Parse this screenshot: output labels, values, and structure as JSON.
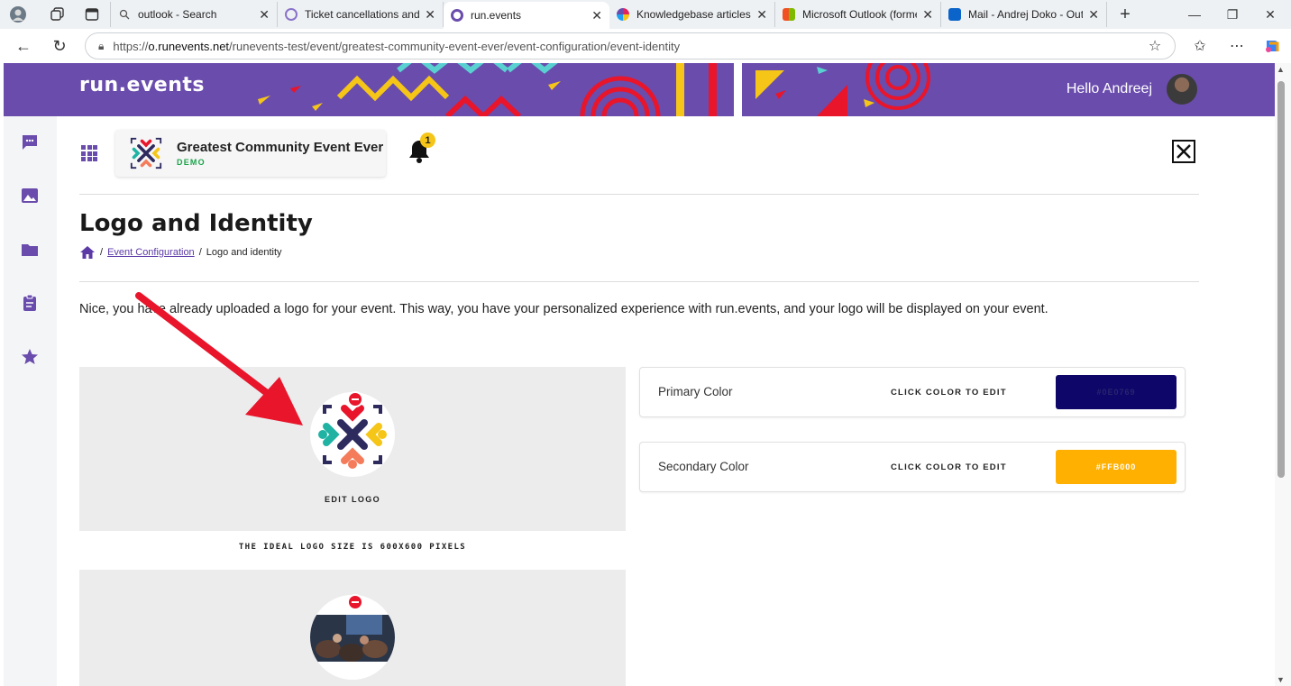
{
  "browser": {
    "tabs": [
      {
        "title": "outlook - Search",
        "fav_color": "#6b6b6b",
        "active": false
      },
      {
        "title": "Ticket cancellations and n",
        "fav_color": "#8a72c9",
        "active": false
      },
      {
        "title": "run.events",
        "fav_color": "#6a4cad",
        "active": true
      },
      {
        "title": "Knowledgebase articles | r",
        "fav_color": "#e0245e",
        "active": false
      },
      {
        "title": "Microsoft Outlook (forme",
        "fav_color": "#f25022",
        "active": false
      },
      {
        "title": "Mail - Andrej Doko - Outl",
        "fav_color": "#0a64c9",
        "active": false
      }
    ],
    "url_scheme": "https://",
    "url_host": "o.runevents.net",
    "url_path": "/runevents-test/event/greatest-community-event-ever/event-configuration/event-identity"
  },
  "header": {
    "brand": "run.events",
    "greeting": "Hello Andreej"
  },
  "event": {
    "name": "Greatest Community Event Ever",
    "tag": "DEMO",
    "notifications": "1"
  },
  "page": {
    "title": "Logo and Identity",
    "breadcrumb": {
      "sep": "/",
      "parent": "Event Configuration",
      "current": "Logo and identity"
    },
    "intro": "Nice, you have already uploaded a logo for your event. This way, you have your personalized experience with run.events, and your logo will be displayed on your event.",
    "edit_logo": "EDIT LOGO",
    "logo_size_hint": "THE IDEAL LOGO SIZE IS 600X600 PIXELS"
  },
  "colors": {
    "hint": "CLICK COLOR TO EDIT",
    "primary": {
      "label": "Primary Color",
      "value": "#0E0769",
      "color": "#0e0769"
    },
    "secondary": {
      "label": "Secondary Color",
      "value": "#FFB000",
      "color": "#ffb000"
    }
  },
  "theme": {
    "brand_purple": "#6a4cad",
    "accent_yellow": "#f5c518",
    "remove_red": "#e8152b"
  }
}
